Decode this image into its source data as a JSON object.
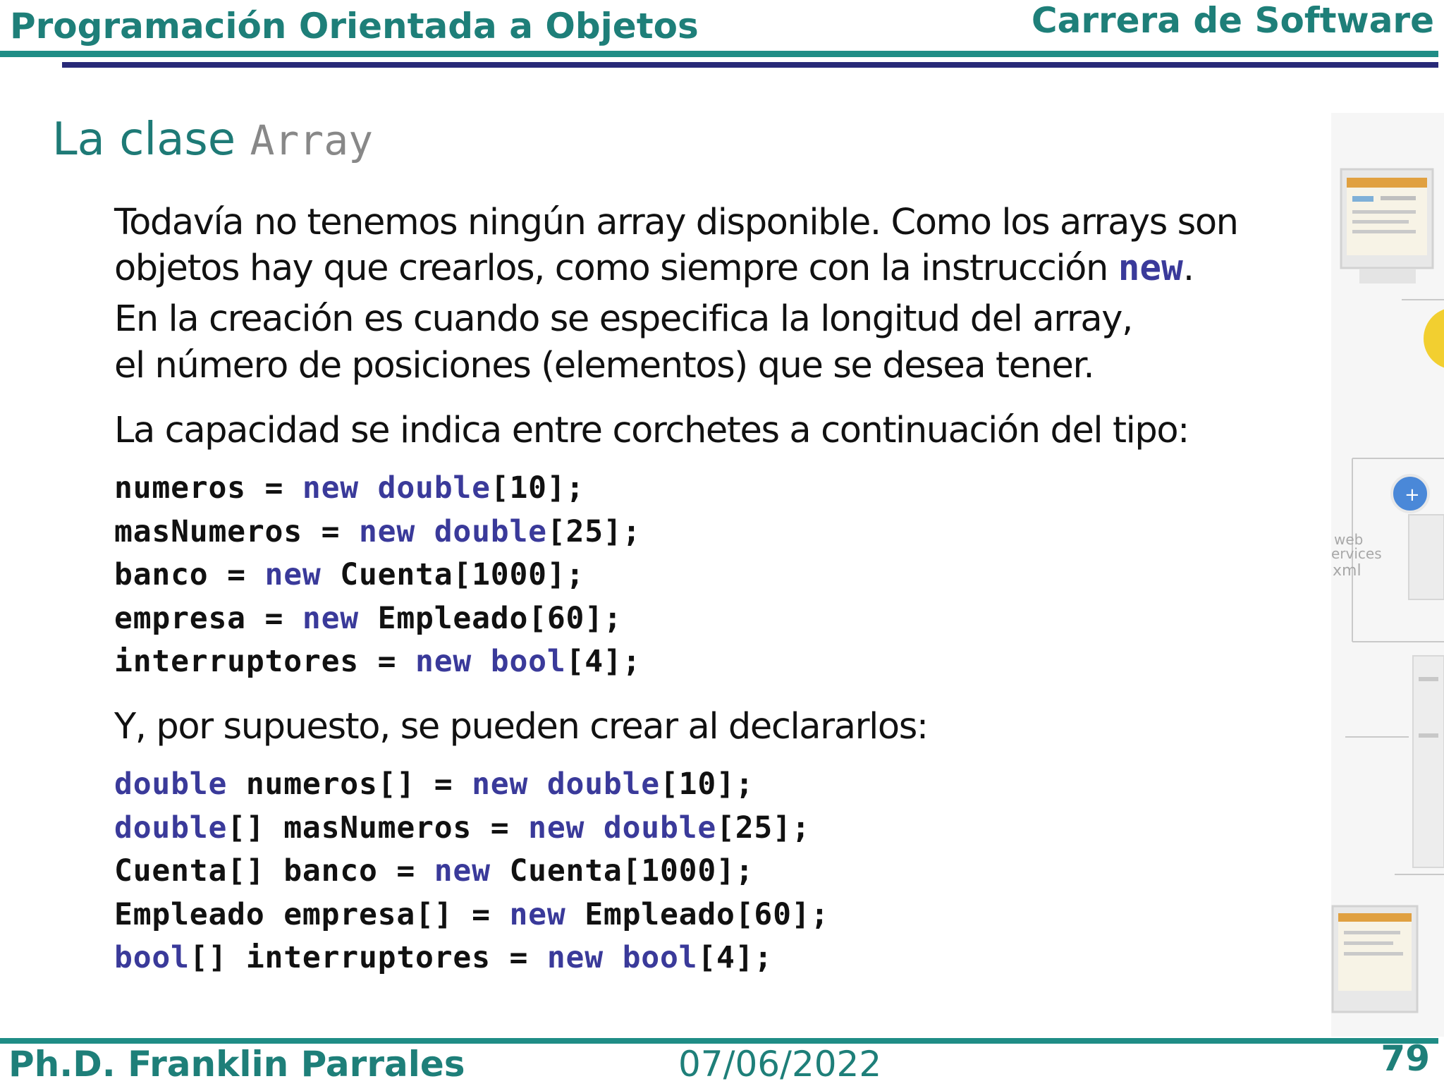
{
  "header": {
    "course": "Programación Orientada a Objetos",
    "program": "Carrera de Software"
  },
  "slide": {
    "title_prefix": "La clase",
    "title_code": "Array",
    "para1_line1": "Todavía no tenemos ningún array disponible. Como los arrays son",
    "para1_line2_pre": "objetos hay que crearlos, como siempre con la instrucción",
    "para1_line2_kw": "new",
    "para1_line2_post": ".",
    "para2_line1": "En la creación es cuando se especifica la longitud del array,",
    "para2_line2": "el número de posiciones (elementos) que se desea tener.",
    "para3": "La capacidad se indica entre corchetes a continuación del tipo:",
    "code1": [
      [
        {
          "t": "numeros = ",
          "k": false
        },
        {
          "t": "new double",
          "k": true
        },
        {
          "t": "[10];",
          "k": false
        }
      ],
      [
        {
          "t": "masNumeros = ",
          "k": false
        },
        {
          "t": "new double",
          "k": true
        },
        {
          "t": "[25];",
          "k": false
        }
      ],
      [
        {
          "t": "banco = ",
          "k": false
        },
        {
          "t": "new",
          "k": true
        },
        {
          "t": " Cuenta[1000];",
          "k": false
        }
      ],
      [
        {
          "t": "empresa = ",
          "k": false
        },
        {
          "t": "new",
          "k": true
        },
        {
          "t": " Empleado[60];",
          "k": false
        }
      ],
      [
        {
          "t": "interruptores = ",
          "k": false
        },
        {
          "t": "new bool",
          "k": true
        },
        {
          "t": "[4];",
          "k": false
        }
      ]
    ],
    "para4": "Y, por supuesto, se pueden crear al declararlos:",
    "code2": [
      [
        {
          "t": "double",
          "k": true
        },
        {
          "t": " numeros[] = ",
          "k": false
        },
        {
          "t": "new double",
          "k": true
        },
        {
          "t": "[10];",
          "k": false
        }
      ],
      [
        {
          "t": "double",
          "k": true
        },
        {
          "t": "[] masNumeros = ",
          "k": false
        },
        {
          "t": "new double",
          "k": true
        },
        {
          "t": "[25];",
          "k": false
        }
      ],
      [
        {
          "t": "Cuenta[] banco = ",
          "k": false
        },
        {
          "t": "new",
          "k": true
        },
        {
          "t": " Cuenta[1000];",
          "k": false
        }
      ],
      [
        {
          "t": "Empleado empresa[] = ",
          "k": false
        },
        {
          "t": "new",
          "k": true
        },
        {
          "t": " Empleado[60];",
          "k": false
        }
      ],
      [
        {
          "t": "bool",
          "k": true
        },
        {
          "t": "[] interruptores = ",
          "k": false
        },
        {
          "t": "new bool",
          "k": true
        },
        {
          "t": "[4];",
          "k": false
        }
      ]
    ]
  },
  "side_art": {
    "label_lines": [
      "web",
      "ervices",
      "xml"
    ],
    "colors": {
      "yellow": "#f2cf30",
      "blue": "#4a88d8"
    }
  },
  "footer": {
    "author": "Ph.D. Franklin Parrales",
    "date": "07/06/2022",
    "page": "79"
  },
  "colors": {
    "teal": "#1e7f79",
    "navy": "#282a78",
    "keyword": "#3a3a9a"
  }
}
